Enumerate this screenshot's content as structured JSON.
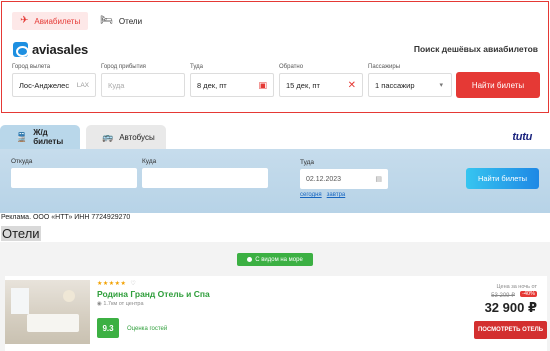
{
  "aviasales": {
    "tabs": [
      {
        "label": "Авиабилеты",
        "icon": "plane-icon",
        "active": true
      },
      {
        "label": "Отели",
        "icon": "bed-icon",
        "active": false
      }
    ],
    "logo_text": "aviasales",
    "tagline": "Поиск дешёвых авиабилетов",
    "fields": {
      "origin": {
        "label": "Город вылета",
        "value": "Лос-Анджелес",
        "code": "LAX"
      },
      "destination": {
        "label": "Город прибытия",
        "placeholder": "Куда"
      },
      "depart": {
        "label": "Туда",
        "value": "8 дек, пт"
      },
      "return": {
        "label": "Обратно",
        "value": "15 дек, пт"
      },
      "passengers": {
        "label": "Пассажиры",
        "value": "1 пассажир"
      }
    },
    "search_button": "Найти билеты",
    "accent_color": "#e53935"
  },
  "tutu": {
    "tabs": [
      {
        "label": "Ж/д билеты",
        "icon": "train-icon",
        "active": true
      },
      {
        "label": "Автобусы",
        "icon": "bus-icon",
        "active": false
      }
    ],
    "logo_text": "tutu",
    "fields": {
      "from": {
        "label": "Откуда",
        "value": ""
      },
      "to": {
        "label": "Куда",
        "value": ""
      },
      "date": {
        "label": "Туда",
        "value": "02.12.2023"
      }
    },
    "quick_dates": [
      "сегодня",
      "завтра"
    ],
    "search_button": "Найти билеты"
  },
  "ad_note": "Реклама. ООО «НТТ» ИНН 7724929270",
  "hotels": {
    "heading": "Отели",
    "filter_button": "С видом на море",
    "card": {
      "stars": "★★★★★",
      "name": "Родина Гранд Отель и Спа",
      "distance": "1.7км от центра",
      "score": "9.3",
      "score_label": "Оценка гостей",
      "price_label": "Цена за ночь от",
      "old_price": "53 209 ₽",
      "discount": "-40%",
      "price": "32 900 ₽",
      "book_button": "ПОСМОТРЕТЬ ОТЕЛЬ"
    }
  }
}
